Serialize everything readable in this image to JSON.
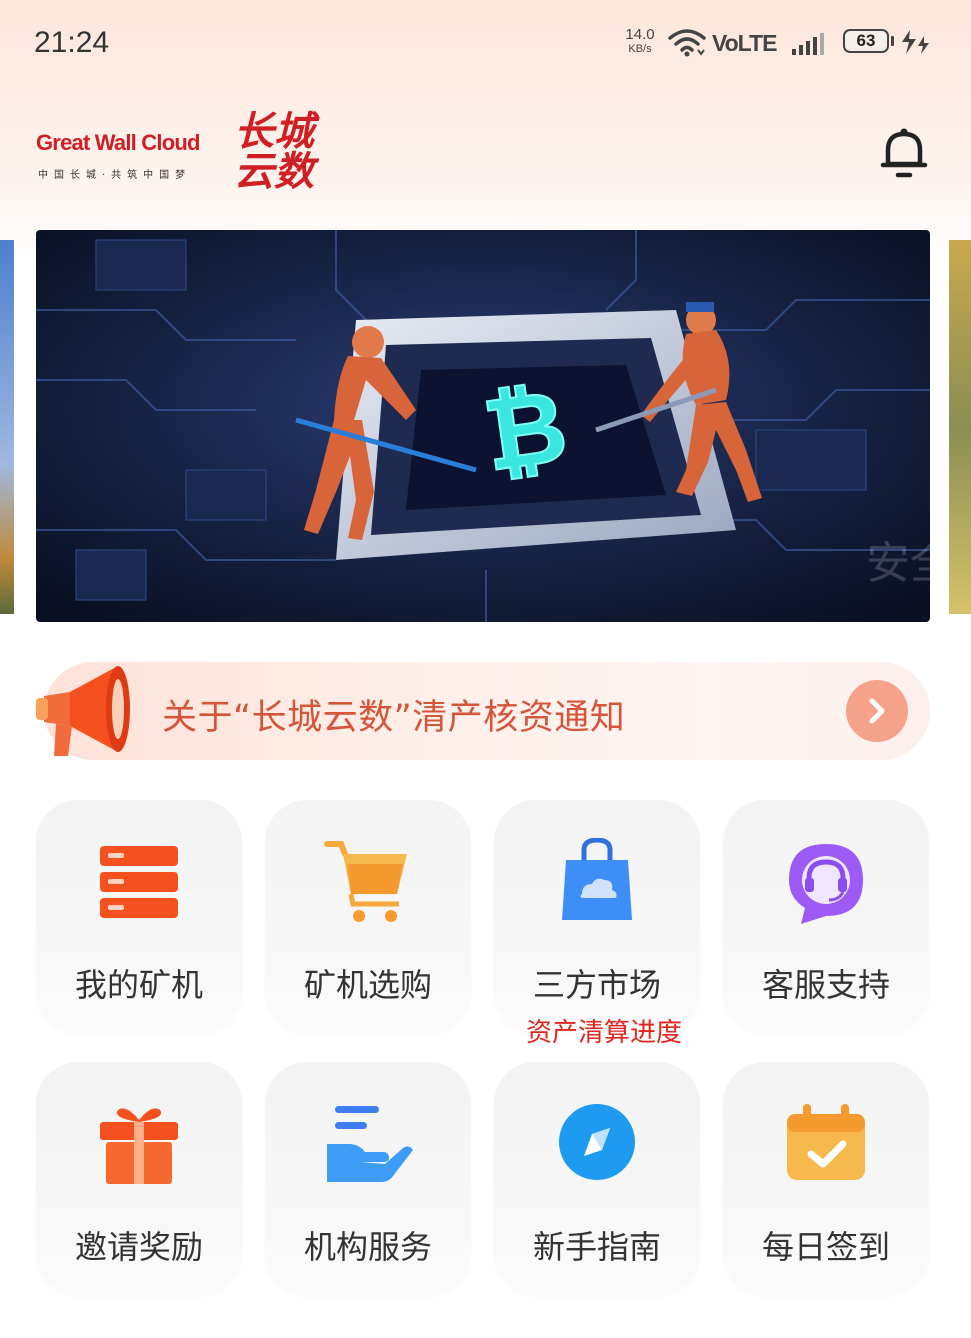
{
  "status_bar": {
    "time": "21:24",
    "net_speed": "14.0",
    "net_speed_unit": "KB/s",
    "network": "VoLTE",
    "battery": "63"
  },
  "header": {
    "logo_en": "Great Wall Cloud",
    "logo_tagline": "中国长城·共筑中国梦",
    "logo_cn": "长城云数",
    "notification_icon": "bell-icon"
  },
  "notice": {
    "text": "关于“长城云数”清产核资通知",
    "icon": "megaphone-icon",
    "arrow_icon": "chevron-right-icon"
  },
  "menu": [
    {
      "label": "我的矿机",
      "icon": "server-icon",
      "color": "#f4511e"
    },
    {
      "label": "矿机选购",
      "icon": "cart-icon",
      "color": "#f7a93b"
    },
    {
      "label": "三方市场",
      "icon": "shopping-bag-icon",
      "color": "#2f8df5"
    },
    {
      "label": "客服支持",
      "icon": "headset-chat-icon",
      "color": "#8a4df0"
    },
    {
      "label": "邀请奖励",
      "icon": "gift-icon",
      "color": "#f4511e"
    },
    {
      "label": "机构服务",
      "icon": "hand-service-icon",
      "color": "#3f7df5"
    },
    {
      "label": "新手指南",
      "icon": "compass-icon",
      "color": "#1e9bf0"
    },
    {
      "label": "每日签到",
      "icon": "calendar-check-icon",
      "color": "#f7a93b"
    }
  ],
  "market_sub": "资产清算进度",
  "colors": {
    "brand_red": "#cf1f24",
    "notice_text": "#d4553a",
    "sub_red": "#e0261f"
  }
}
